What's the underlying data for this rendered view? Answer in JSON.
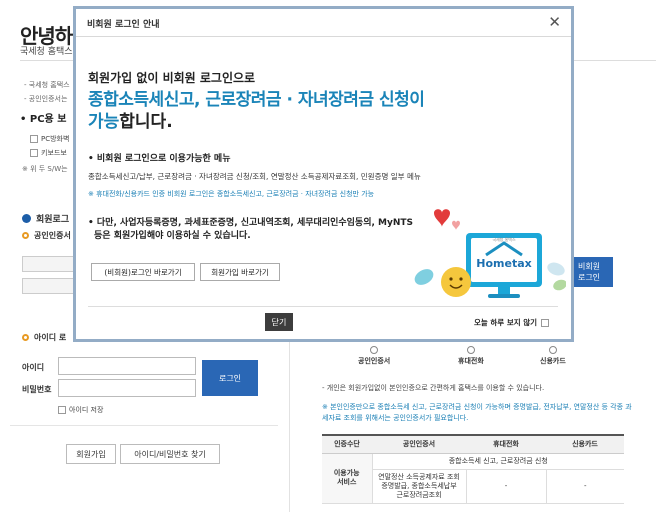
{
  "page": {
    "title": "안녕하",
    "subtitle": "국세청 홈택스",
    "notes": [
      "- 국세청 홈택스",
      "- 공인인증서는"
    ],
    "pc_title": "• PC용 보",
    "checkbox_items": [
      "PC방화벽",
      "키보드보"
    ],
    "windows_note": "※ 위 두 S/W는"
  },
  "left": {
    "cert_login_title": "회원로그",
    "cert_login_sub": "공인인증서",
    "id_login_title": "아이디 로",
    "id_label": "아이디",
    "pw_label": "비밀번호",
    "login_button": "로그인",
    "save_id": "아이디 저장",
    "signup_button": "회원가입",
    "find_button": "아이디/비밀번호 찾기"
  },
  "right": {
    "nonmember_login_button": "비회원\n로그인",
    "radios": [
      "공인인증서",
      "휴대전화",
      "신용카드"
    ],
    "note1": "- 개인은 회원가입없이 본인인증으로 간편하게 홈택스를 이용할 수 있습니다.",
    "note2": "※ 본인인증만으로 종합소득세 신고, 근로장려금 신청이 가능하며 증명발급, 전자납부, 연말정산 등 각종 과세자료 조회를 위해서는 공인인증서가 필요합니다.",
    "table": {
      "headers": [
        "인증수단",
        "공인인증서",
        "휴대전화",
        "신용카드"
      ],
      "row_header": "이용가능\n서비스",
      "row1": "종합소득세 신고, 근로장려금 신청",
      "row2_cert": "연말정산 소득공제자료 조회\n증명발급, 종합소득세납부\n근로장려금조회",
      "row2_phone": "-",
      "row2_card": "-"
    }
  },
  "modal": {
    "title": "비회원 로그인 안내",
    "close_glyph": "✕",
    "headline_small": "회원가입 없이 비회원 로그인으로",
    "headline_big1": "종합소득세신고, 근로장려금 · 자녀장려금 신청이",
    "headline_big2_a": "가능",
    "headline_big2_b": "합니다.",
    "section_title": "• 비회원 로그인으로 이용가능한 메뉴",
    "menu_list": "종합소득세신고/납부, 근로장려금 · 자녀장려금 신청/조회, 연말정산 소득공제자료조회, 민원증명 일부 메뉴",
    "menu_note": "※ 휴대전화/신용카드 인증 비회원 로그인은 종합소득세신고, 근로장려금 · 자녀장려금 신청만 가능",
    "bullet2_line1": "• 다만, 사업자등록증명, 과세표준증명, 신고내역조회, 세무대리인수임동의, MyNTS",
    "bullet2_line2": "등은 회원가입해야 이용하실 수 있습니다.",
    "btn_nonmember_login": "(비회원)로그인 바로가기",
    "btn_signup": "회원가입 바로가기",
    "btn_close": "닫기",
    "no_today": "오늘 하루 보지 않기",
    "illus_brand": "Hometax",
    "illus_brand_sub": "국세청 홈택스"
  },
  "colors": {
    "accent_blue": "#1a84b8",
    "button_blue": "#2a67b5",
    "modal_border": "#93acc6"
  }
}
